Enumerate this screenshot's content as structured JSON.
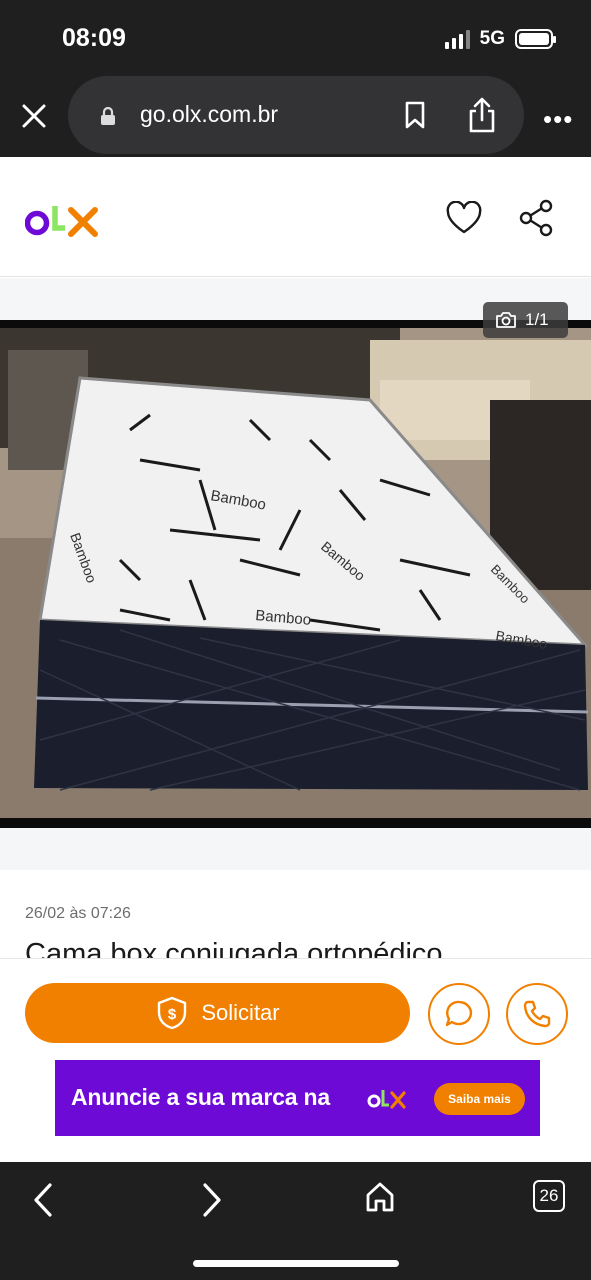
{
  "status": {
    "time": "08:09",
    "network": "5G"
  },
  "browser": {
    "url": "go.olx.com.br",
    "tab_count": "26"
  },
  "header": {
    "logo_letters": [
      "o",
      "l",
      "x"
    ],
    "colors": {
      "o": "#6e0ad6",
      "l": "#8ce563",
      "x": "#f28000"
    }
  },
  "gallery": {
    "counter": "1/1",
    "mattress_labels": [
      "Bamboo",
      "Bamboo",
      "Bamboo",
      "Bamboo",
      "Bamboo",
      "Bamboo"
    ]
  },
  "listing": {
    "date": "26/02 às 07:26",
    "title": "Cama box conjugada ortopédico"
  },
  "actions": {
    "solicitar_label": "Solicitar",
    "accent": "#f28000"
  },
  "banner": {
    "text": "Anuncie a sua marca na",
    "brand": "olx",
    "cta": "Saiba mais",
    "background": "#6e0ad6"
  },
  "icons": [
    "close-icon",
    "lock-icon",
    "bookmark-icon",
    "share-icon",
    "more-icon",
    "heart-icon",
    "share-nodes-icon",
    "camera-icon",
    "shield-dollar-icon",
    "chat-icon",
    "phone-icon",
    "back-icon",
    "forward-icon",
    "home-icon",
    "tabs-icon"
  ]
}
